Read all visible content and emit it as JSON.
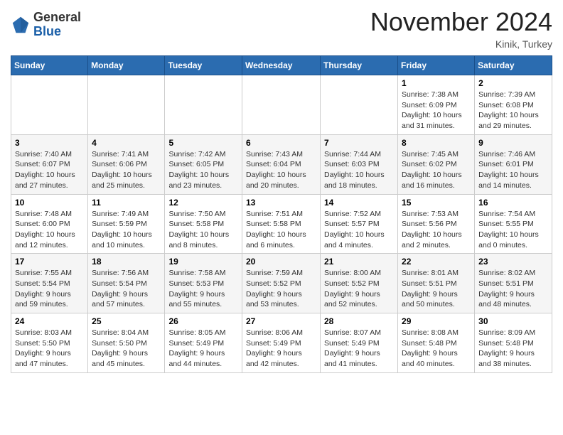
{
  "header": {
    "logo_line1": "General",
    "logo_line2": "Blue",
    "month": "November 2024",
    "location": "Kinik, Turkey"
  },
  "weekdays": [
    "Sunday",
    "Monday",
    "Tuesday",
    "Wednesday",
    "Thursday",
    "Friday",
    "Saturday"
  ],
  "weeks": [
    [
      {
        "day": "",
        "info": ""
      },
      {
        "day": "",
        "info": ""
      },
      {
        "day": "",
        "info": ""
      },
      {
        "day": "",
        "info": ""
      },
      {
        "day": "",
        "info": ""
      },
      {
        "day": "1",
        "info": "Sunrise: 7:38 AM\nSunset: 6:09 PM\nDaylight: 10 hours\nand 31 minutes."
      },
      {
        "day": "2",
        "info": "Sunrise: 7:39 AM\nSunset: 6:08 PM\nDaylight: 10 hours\nand 29 minutes."
      }
    ],
    [
      {
        "day": "3",
        "info": "Sunrise: 7:40 AM\nSunset: 6:07 PM\nDaylight: 10 hours\nand 27 minutes."
      },
      {
        "day": "4",
        "info": "Sunrise: 7:41 AM\nSunset: 6:06 PM\nDaylight: 10 hours\nand 25 minutes."
      },
      {
        "day": "5",
        "info": "Sunrise: 7:42 AM\nSunset: 6:05 PM\nDaylight: 10 hours\nand 23 minutes."
      },
      {
        "day": "6",
        "info": "Sunrise: 7:43 AM\nSunset: 6:04 PM\nDaylight: 10 hours\nand 20 minutes."
      },
      {
        "day": "7",
        "info": "Sunrise: 7:44 AM\nSunset: 6:03 PM\nDaylight: 10 hours\nand 18 minutes."
      },
      {
        "day": "8",
        "info": "Sunrise: 7:45 AM\nSunset: 6:02 PM\nDaylight: 10 hours\nand 16 minutes."
      },
      {
        "day": "9",
        "info": "Sunrise: 7:46 AM\nSunset: 6:01 PM\nDaylight: 10 hours\nand 14 minutes."
      }
    ],
    [
      {
        "day": "10",
        "info": "Sunrise: 7:48 AM\nSunset: 6:00 PM\nDaylight: 10 hours\nand 12 minutes."
      },
      {
        "day": "11",
        "info": "Sunrise: 7:49 AM\nSunset: 5:59 PM\nDaylight: 10 hours\nand 10 minutes."
      },
      {
        "day": "12",
        "info": "Sunrise: 7:50 AM\nSunset: 5:58 PM\nDaylight: 10 hours\nand 8 minutes."
      },
      {
        "day": "13",
        "info": "Sunrise: 7:51 AM\nSunset: 5:58 PM\nDaylight: 10 hours\nand 6 minutes."
      },
      {
        "day": "14",
        "info": "Sunrise: 7:52 AM\nSunset: 5:57 PM\nDaylight: 10 hours\nand 4 minutes."
      },
      {
        "day": "15",
        "info": "Sunrise: 7:53 AM\nSunset: 5:56 PM\nDaylight: 10 hours\nand 2 minutes."
      },
      {
        "day": "16",
        "info": "Sunrise: 7:54 AM\nSunset: 5:55 PM\nDaylight: 10 hours\nand 0 minutes."
      }
    ],
    [
      {
        "day": "17",
        "info": "Sunrise: 7:55 AM\nSunset: 5:54 PM\nDaylight: 9 hours\nand 59 minutes."
      },
      {
        "day": "18",
        "info": "Sunrise: 7:56 AM\nSunset: 5:54 PM\nDaylight: 9 hours\nand 57 minutes."
      },
      {
        "day": "19",
        "info": "Sunrise: 7:58 AM\nSunset: 5:53 PM\nDaylight: 9 hours\nand 55 minutes."
      },
      {
        "day": "20",
        "info": "Sunrise: 7:59 AM\nSunset: 5:52 PM\nDaylight: 9 hours\nand 53 minutes."
      },
      {
        "day": "21",
        "info": "Sunrise: 8:00 AM\nSunset: 5:52 PM\nDaylight: 9 hours\nand 52 minutes."
      },
      {
        "day": "22",
        "info": "Sunrise: 8:01 AM\nSunset: 5:51 PM\nDaylight: 9 hours\nand 50 minutes."
      },
      {
        "day": "23",
        "info": "Sunrise: 8:02 AM\nSunset: 5:51 PM\nDaylight: 9 hours\nand 48 minutes."
      }
    ],
    [
      {
        "day": "24",
        "info": "Sunrise: 8:03 AM\nSunset: 5:50 PM\nDaylight: 9 hours\nand 47 minutes."
      },
      {
        "day": "25",
        "info": "Sunrise: 8:04 AM\nSunset: 5:50 PM\nDaylight: 9 hours\nand 45 minutes."
      },
      {
        "day": "26",
        "info": "Sunrise: 8:05 AM\nSunset: 5:49 PM\nDaylight: 9 hours\nand 44 minutes."
      },
      {
        "day": "27",
        "info": "Sunrise: 8:06 AM\nSunset: 5:49 PM\nDaylight: 9 hours\nand 42 minutes."
      },
      {
        "day": "28",
        "info": "Sunrise: 8:07 AM\nSunset: 5:49 PM\nDaylight: 9 hours\nand 41 minutes."
      },
      {
        "day": "29",
        "info": "Sunrise: 8:08 AM\nSunset: 5:48 PM\nDaylight: 9 hours\nand 40 minutes."
      },
      {
        "day": "30",
        "info": "Sunrise: 8:09 AM\nSunset: 5:48 PM\nDaylight: 9 hours\nand 38 minutes."
      }
    ]
  ]
}
